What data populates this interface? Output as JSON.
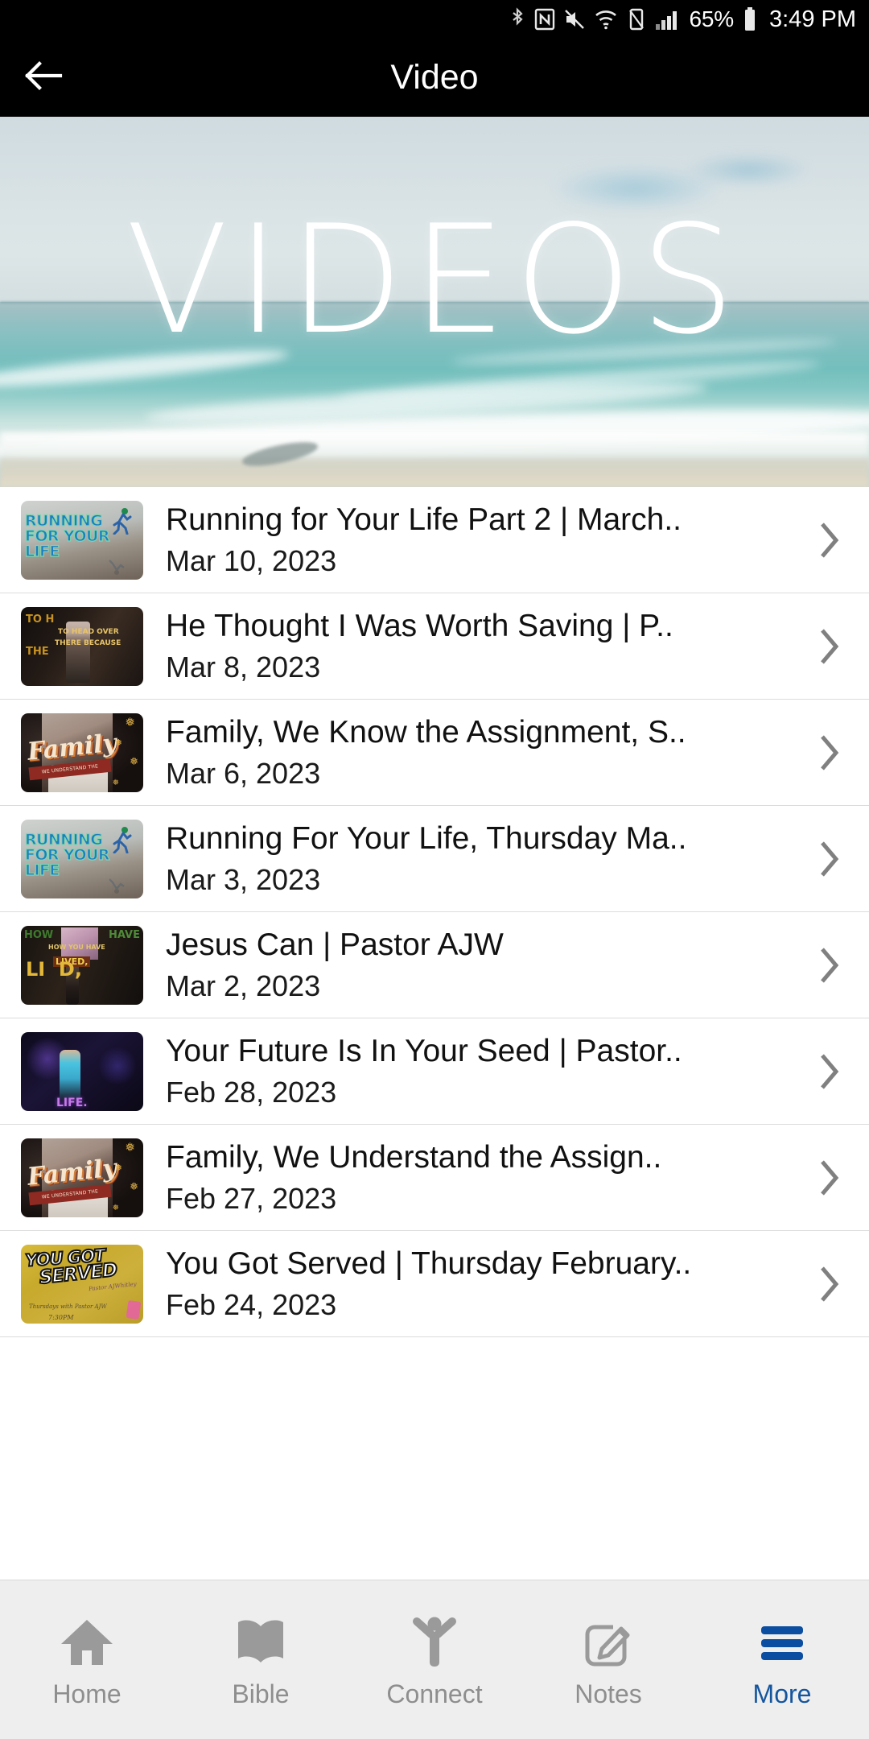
{
  "status_bar": {
    "icons": [
      "bluetooth-icon",
      "nfc-icon",
      "mute-icon",
      "wifi-icon",
      "vibrate-icon",
      "signal-icon"
    ],
    "battery_percent": "65%",
    "battery_icon": "battery-icon",
    "time": "3:49 PM"
  },
  "header": {
    "back_icon": "back-arrow-icon",
    "title": "Video"
  },
  "hero": {
    "overlay_text": "VIDEOS",
    "image_alt": "aerial-ocean-beach-waves"
  },
  "list": {
    "chevron_icon": "chevron-right-icon",
    "items": [
      {
        "title": "Running for Your Life Part 2 | March..",
        "date": "Mar 10, 2023",
        "thumb": "running-for-your-life",
        "thumb_text": [
          "RUNNING",
          "FOR YOUR",
          "LIFE"
        ]
      },
      {
        "title": "He Thought I Was Worth Saving | P..",
        "date": "Mar 8, 2023",
        "thumb": "he-thought-i-was-worth-saving",
        "thumb_text": [
          "TO H",
          "TO HEAD OVER",
          "THERE BECAUSE",
          "THE",
          "AUSE"
        ]
      },
      {
        "title": "Family, We Know the Assignment, S..",
        "date": "Mar 6, 2023",
        "thumb": "family",
        "thumb_text": [
          "Family",
          "WE UNDERSTAND THE ASSIGNMENT"
        ]
      },
      {
        "title": "Running For Your Life, Thursday Ma..",
        "date": "Mar 3, 2023",
        "thumb": "running-for-your-life",
        "thumb_text": [
          "RUNNING",
          "FOR YOUR",
          "LIFE"
        ]
      },
      {
        "title": "Jesus Can | Pastor AJW",
        "date": "Mar 2, 2023",
        "thumb": "jesus-can",
        "thumb_text": [
          "HOW",
          "HAVE",
          "HOW YOU HAVE",
          "LIVED,",
          "LIVED,"
        ]
      },
      {
        "title": "Your Future Is In Your Seed | Pastor..",
        "date": "Feb 28, 2023",
        "thumb": "your-future-is-in-your-seed",
        "thumb_text": [
          "LIFE."
        ]
      },
      {
        "title": "Family, We Understand the Assign..",
        "date": "Feb 27, 2023",
        "thumb": "family",
        "thumb_text": [
          "Family",
          "WE UNDERSTAND THE ASSIGNMENT"
        ]
      },
      {
        "title": "You Got Served | Thursday February..",
        "date": "Feb 24, 2023",
        "thumb": "you-got-served",
        "thumb_text": [
          "YOU GOT",
          "SERVED",
          "Thursdays with Pastor AJW",
          "7:30PM"
        ]
      }
    ]
  },
  "tabbar": {
    "active": "More",
    "active_color": "#14559e",
    "inactive_color": "#8e8e8e",
    "items": [
      {
        "label": "Home",
        "icon": "home-icon",
        "active": false
      },
      {
        "label": "Bible",
        "icon": "book-icon",
        "active": false
      },
      {
        "label": "Connect",
        "icon": "person-icon",
        "active": false
      },
      {
        "label": "Notes",
        "icon": "pencil-square-icon",
        "active": false
      },
      {
        "label": "More",
        "icon": "hamburger-icon",
        "active": true
      }
    ]
  }
}
